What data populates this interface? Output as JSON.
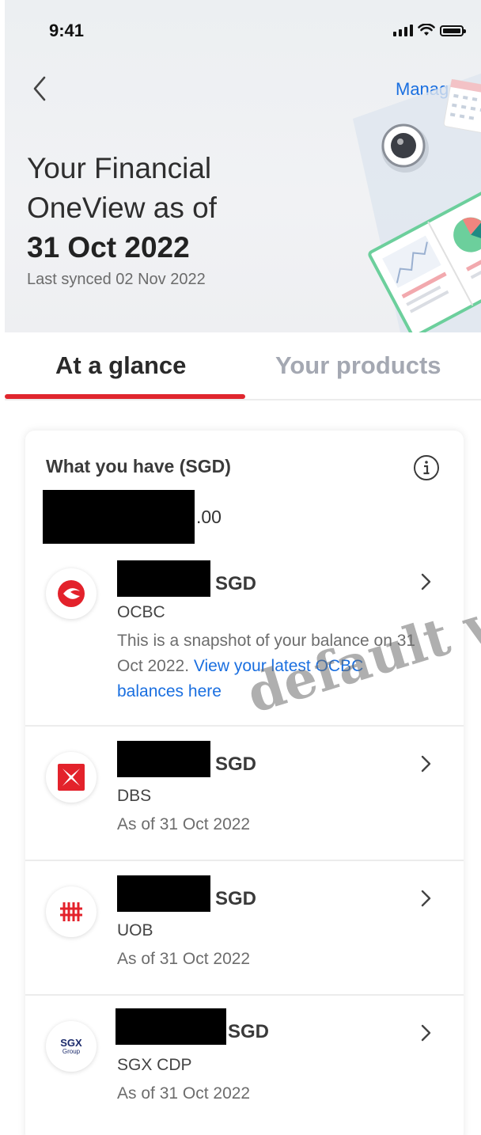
{
  "status_bar": {
    "time": "9:41"
  },
  "header": {
    "manage_label": "Manage",
    "title_line1": "Your Financial",
    "title_line2": "OneView as of",
    "title_date": "31 Oct 2022",
    "last_synced": "Last synced 02 Nov 2022"
  },
  "tabs": [
    {
      "label": "At a glance",
      "active": true
    },
    {
      "label": "Your products",
      "active": false
    }
  ],
  "summary": {
    "heading": "What you have (SGD)",
    "total_suffix": ".00"
  },
  "accounts": [
    {
      "currency": "SGD",
      "name": "OCBC",
      "note": "This is a snapshot of your balance on 31 Oct 2022. ",
      "note_link": "View your latest OCBC balances here",
      "logo": "ocbc-logo"
    },
    {
      "currency": "SGD",
      "name": "DBS",
      "note": "As of 31 Oct 2022",
      "logo": "dbs-logo"
    },
    {
      "currency": "SGD",
      "name": "UOB",
      "note": "As of 31 Oct 2022",
      "logo": "uob-logo"
    },
    {
      "currency": "SGD",
      "name": "SGX CDP",
      "note": "As of 31 Oct 2022",
      "logo": "sgx-logo",
      "logo_text": "SGX",
      "logo_subtext": "Group"
    }
  ],
  "watermark": "default w",
  "colors": {
    "accent_red": "#e0262e",
    "link_blue": "#1a6fe0",
    "inactive_tab": "#a4a8b2"
  }
}
